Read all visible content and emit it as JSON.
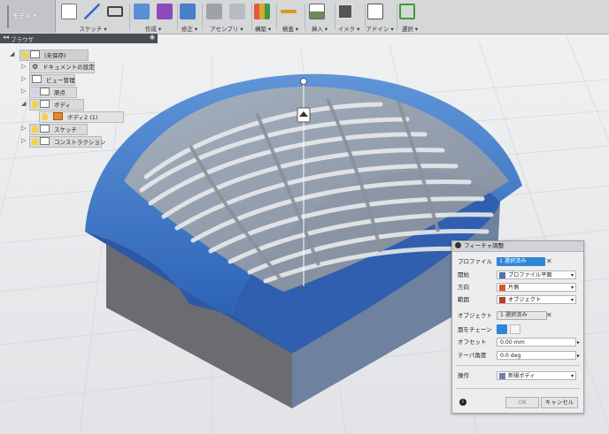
{
  "toolbar": {
    "workspace": "モデル ▾",
    "groups": [
      {
        "label": "スケッチ ▾",
        "icons": [
          "sketch-icon",
          "line-icon",
          "rectangle-icon"
        ]
      },
      {
        "label": "作成 ▾",
        "icons": [
          "extrude-icon",
          "sculpt-icon"
        ]
      },
      {
        "label": "修正 ▾",
        "icons": [
          "modify-icon"
        ]
      },
      {
        "label": "アセンブリ ▾",
        "icons": [
          "assembly-icon",
          "joint-icon"
        ]
      },
      {
        "label": "構築 ▾",
        "icons": [
          "construct-icon"
        ]
      },
      {
        "label": "検査 ▾",
        "icons": [
          "inspect-icon"
        ]
      },
      {
        "label": "挿入 ▾",
        "icons": [
          "insert-icon"
        ]
      },
      {
        "label": "イメク ▾",
        "icons": [
          "image-icon"
        ]
      },
      {
        "label": "アドイン ▾",
        "icons": [
          "addin-icon"
        ]
      },
      {
        "label": "選択 ▾",
        "icons": [
          "select-icon"
        ]
      }
    ]
  },
  "browser": {
    "title": "ブラウザ",
    "items": [
      {
        "label": "(未保存)",
        "root": true
      },
      {
        "label": "ドキュメントの設定"
      },
      {
        "label": "ビュー管理"
      },
      {
        "label": "原点"
      },
      {
        "label": "ボディ"
      },
      {
        "label": "ボディ2 (1)",
        "highlight": true
      },
      {
        "label": "スケッチ"
      },
      {
        "label": "コンストラクション"
      }
    ]
  },
  "dialog": {
    "title": "フィーチャ調整",
    "rows": {
      "profile": {
        "label": "プロファイル",
        "value": "1 選択済み"
      },
      "start": {
        "label": "開始",
        "value": "プロファイル平面"
      },
      "direction": {
        "label": "方向",
        "value": "片側"
      },
      "extent": {
        "label": "範囲",
        "value": "オブジェクト"
      },
      "object": {
        "label": "オブジェクト",
        "value": "1 選択済み"
      },
      "chain": {
        "label": "面をチェーン"
      },
      "offset": {
        "label": "オフセット",
        "value": "0.00 mm"
      },
      "taper": {
        "label": "テーパ角度",
        "value": "0.0 deg"
      },
      "operation": {
        "label": "操作",
        "value": "新規ボディ"
      }
    },
    "ok": "OK",
    "cancel": "キャンセル"
  },
  "canvas": {
    "colors": {
      "body_blue": "#3a78c8",
      "box_gray": "#6a6c72",
      "grid": "#cfd2d6"
    }
  }
}
